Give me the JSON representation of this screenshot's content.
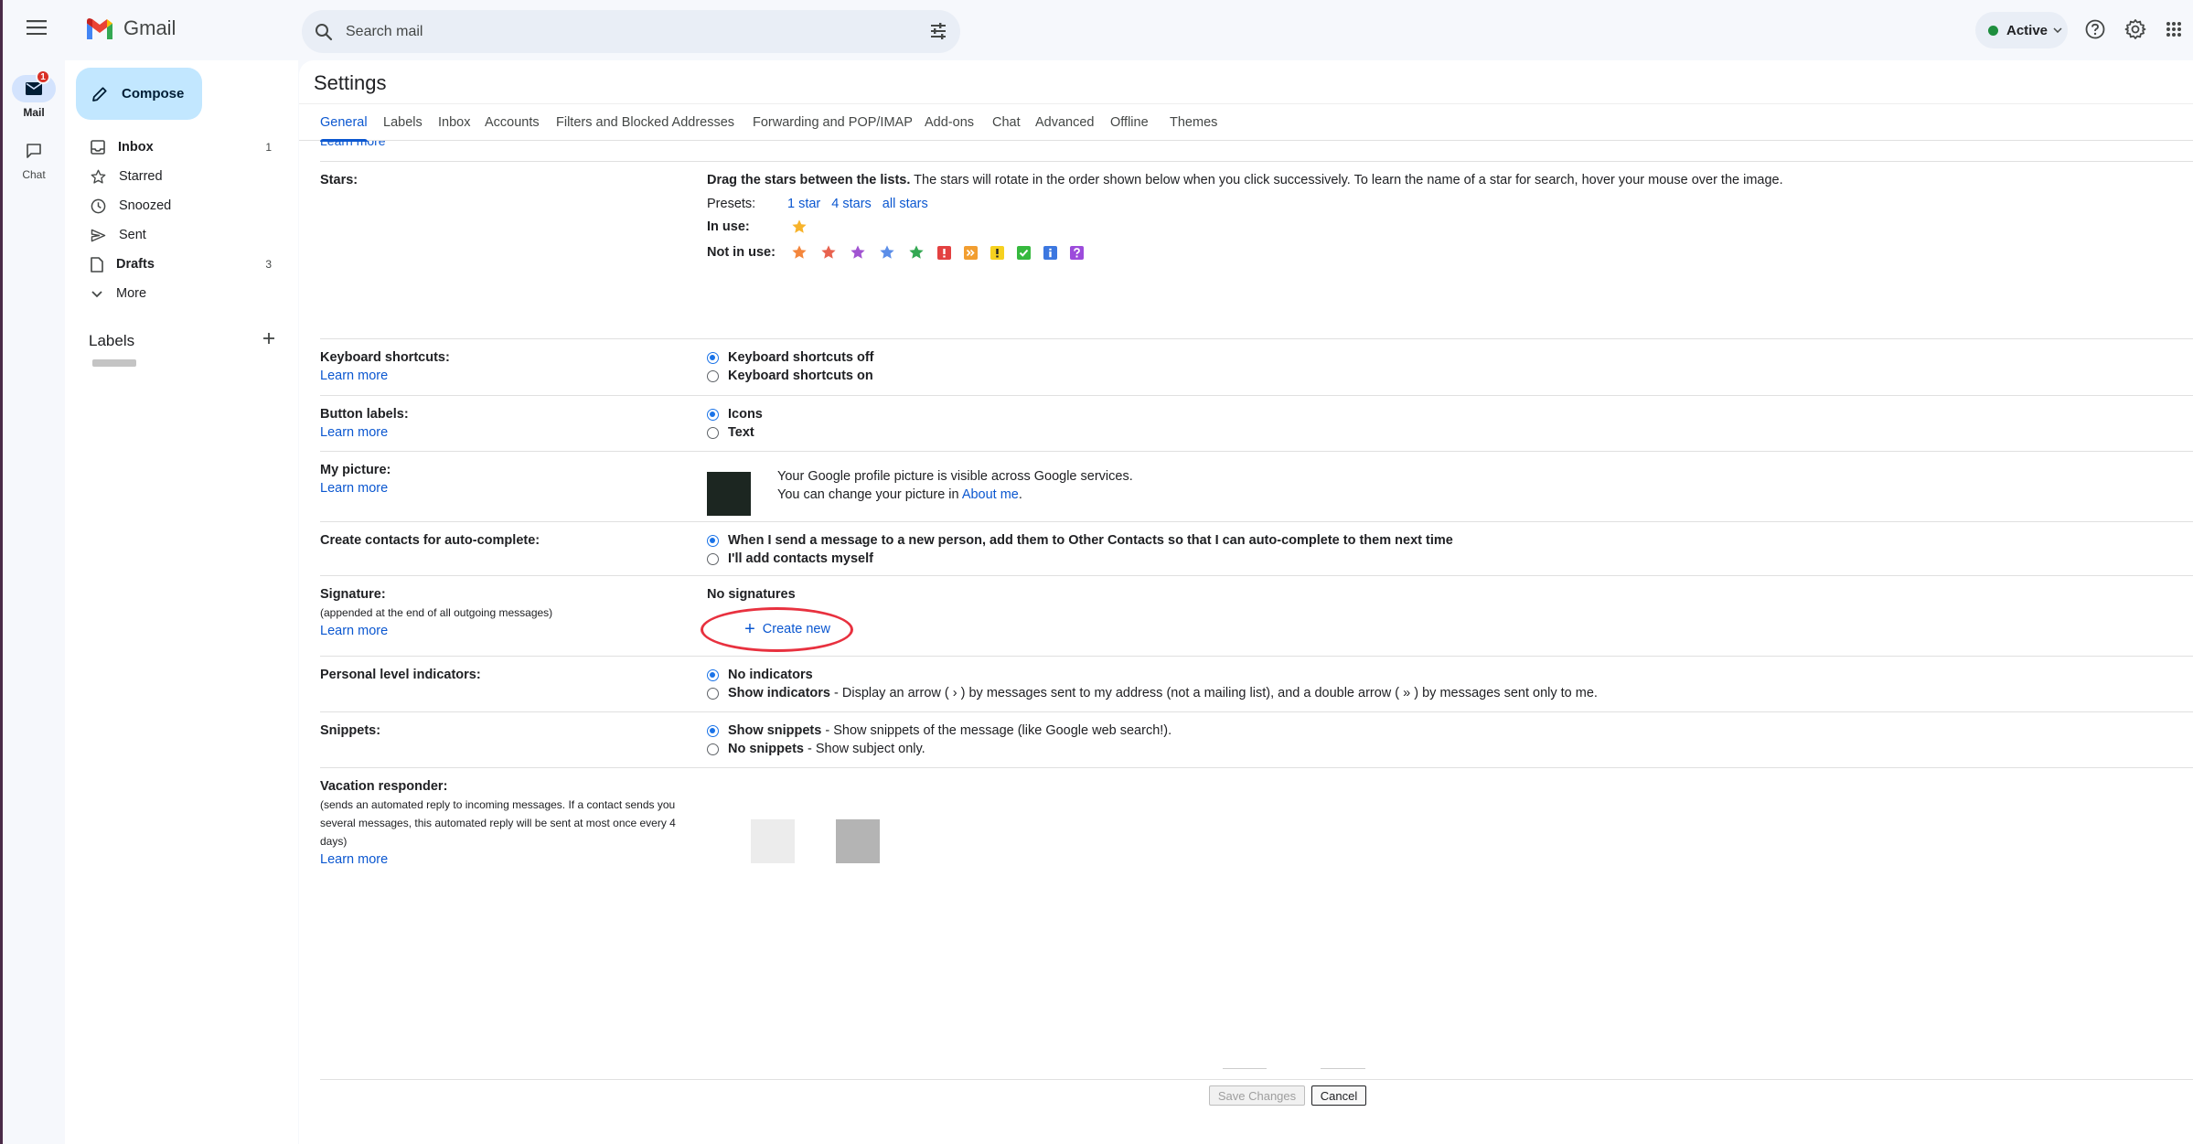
{
  "app": {
    "name": "Gmail"
  },
  "search": {
    "placeholder": "Search mail"
  },
  "status": {
    "label": "Active"
  },
  "rail": {
    "mail_label": "Mail",
    "mail_badge": "1",
    "chat_label": "Chat"
  },
  "nav": {
    "compose": "Compose",
    "items": [
      {
        "label": "Inbox",
        "count": "1"
      },
      {
        "label": "Starred",
        "count": ""
      },
      {
        "label": "Snoozed",
        "count": ""
      },
      {
        "label": "Sent",
        "count": ""
      },
      {
        "label": "Drafts",
        "count": "3"
      },
      {
        "label": "More",
        "count": ""
      }
    ],
    "labels_heading": "Labels"
  },
  "settings": {
    "title": "Settings",
    "tabs": [
      "General",
      "Labels",
      "Inbox",
      "Accounts",
      "Filters and Blocked Addresses",
      "Forwarding and POP/IMAP",
      "Add-ons",
      "Chat",
      "Advanced",
      "Offline",
      "Themes"
    ],
    "cut_link": "Learn more",
    "stars": {
      "label": "Stars:",
      "desc_bold": "Drag the stars between the lists.",
      "desc": " The stars will rotate in the order shown below when you click successively. To learn the name of a star for search, hover your mouse over the image.",
      "presets_label": "Presets:",
      "presets": [
        "1 star",
        "4 stars",
        "all stars"
      ],
      "in_use_label": "In use:",
      "not_in_use_label": "Not in use:",
      "colors": {
        "yellow": "#f7b32b",
        "orange": "#f4863c",
        "red": "#e8624f",
        "purple": "#a154d1",
        "blue": "#5c8ee8",
        "green": "#34a853",
        "red_bang_bg": "#e34141",
        "orange_guil_bg": "#f29e30",
        "yellow_bang_bg": "#f6d11f",
        "green_check_bg": "#36b93e",
        "blue_info_bg": "#3c77e0",
        "purple_q_bg": "#9c4bdb"
      }
    },
    "keyboard": {
      "label": "Keyboard shortcuts:",
      "learn": "Learn more",
      "options": [
        "Keyboard shortcuts off",
        "Keyboard shortcuts on"
      ],
      "selected": 0
    },
    "button_labels": {
      "label": "Button labels:",
      "learn": "Learn more",
      "options": [
        "Icons",
        "Text"
      ],
      "selected": 0
    },
    "picture": {
      "label": "My picture:",
      "learn": "Learn more",
      "line1": "Your Google profile picture is visible across Google services.",
      "line2_prefix": "You can change your picture in ",
      "line2_link": "About me",
      "line2_suffix": "."
    },
    "contacts": {
      "label": "Create contacts for auto-complete:",
      "options": [
        "When I send a message to a new person, add them to Other Contacts so that I can auto-complete to them next time",
        "I'll add contacts myself"
      ],
      "selected": 0
    },
    "signature": {
      "label": "Signature:",
      "sub": "(appended at the end of all outgoing messages)",
      "learn": "Learn more",
      "none": "No signatures",
      "create": "Create new"
    },
    "indicators": {
      "label": "Personal level indicators:",
      "opt1": "No indicators",
      "opt2_strong": "Show indicators",
      "opt2_desc": " - Display an arrow ( › ) by messages sent to my address (not a mailing list), and a double arrow ( » ) by messages sent only to me."
    },
    "snippets": {
      "label": "Snippets:",
      "opt1_strong": "Show snippets",
      "opt1_desc": " - Show snippets of the message (like Google web search!).",
      "opt2_strong": "No snippets",
      "opt2_desc": " - Show subject only."
    },
    "vacation": {
      "label": "Vacation responder:",
      "sub": "(sends an automated reply to incoming messages. If a contact sends you several messages, this automated reply will be sent at most once every 4 days)",
      "learn": "Learn more"
    },
    "footer": {
      "save": "Save Changes",
      "cancel": "Cancel"
    }
  },
  "colors": {
    "accent": "#0b57d0",
    "compose_bg": "#c2e7ff",
    "highlight_ring": "#e8313f",
    "status_green": "#1e8e3e"
  }
}
